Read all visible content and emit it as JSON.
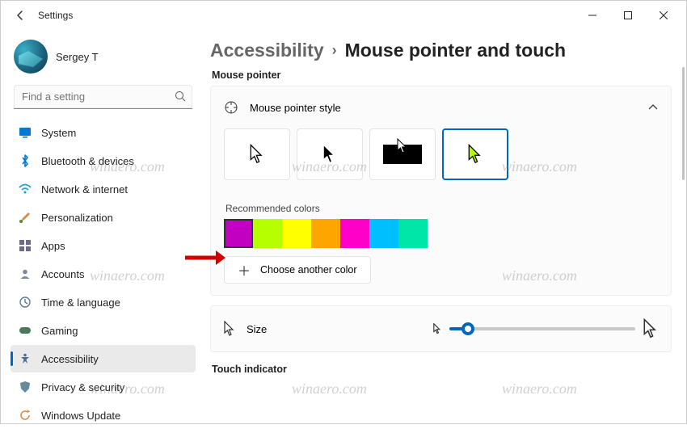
{
  "window": {
    "title": "Settings"
  },
  "user": {
    "name": "Sergey T"
  },
  "search": {
    "placeholder": "Find a setting"
  },
  "nav": {
    "items": [
      {
        "label": "System"
      },
      {
        "label": "Bluetooth & devices"
      },
      {
        "label": "Network & internet"
      },
      {
        "label": "Personalization"
      },
      {
        "label": "Apps"
      },
      {
        "label": "Accounts"
      },
      {
        "label": "Time & language"
      },
      {
        "label": "Gaming"
      },
      {
        "label": "Accessibility"
      },
      {
        "label": "Privacy & security"
      },
      {
        "label": "Windows Update"
      }
    ],
    "selected_index": 8
  },
  "breadcrumb": {
    "category": "Accessibility",
    "page": "Mouse pointer and touch"
  },
  "sections": {
    "mouse_pointer_label": "Mouse pointer",
    "style_card_title": "Mouse pointer style",
    "recommended_label": "Recommended colors",
    "choose_another_label": "Choose another color",
    "size_label": "Size",
    "touch_indicator_label": "Touch indicator"
  },
  "pointer_styles": {
    "options": [
      "white",
      "black",
      "inverted",
      "custom"
    ],
    "selected_index": 3
  },
  "recommended_colors": {
    "values": [
      "#c200c2",
      "#b6ff00",
      "#ffff00",
      "#ffa500",
      "#ff00c8",
      "#00bfff",
      "#00e6a8"
    ],
    "selected_index": 0
  },
  "size_slider": {
    "min": 1,
    "max": 15,
    "value": 1
  },
  "watermark": "winaero.com"
}
